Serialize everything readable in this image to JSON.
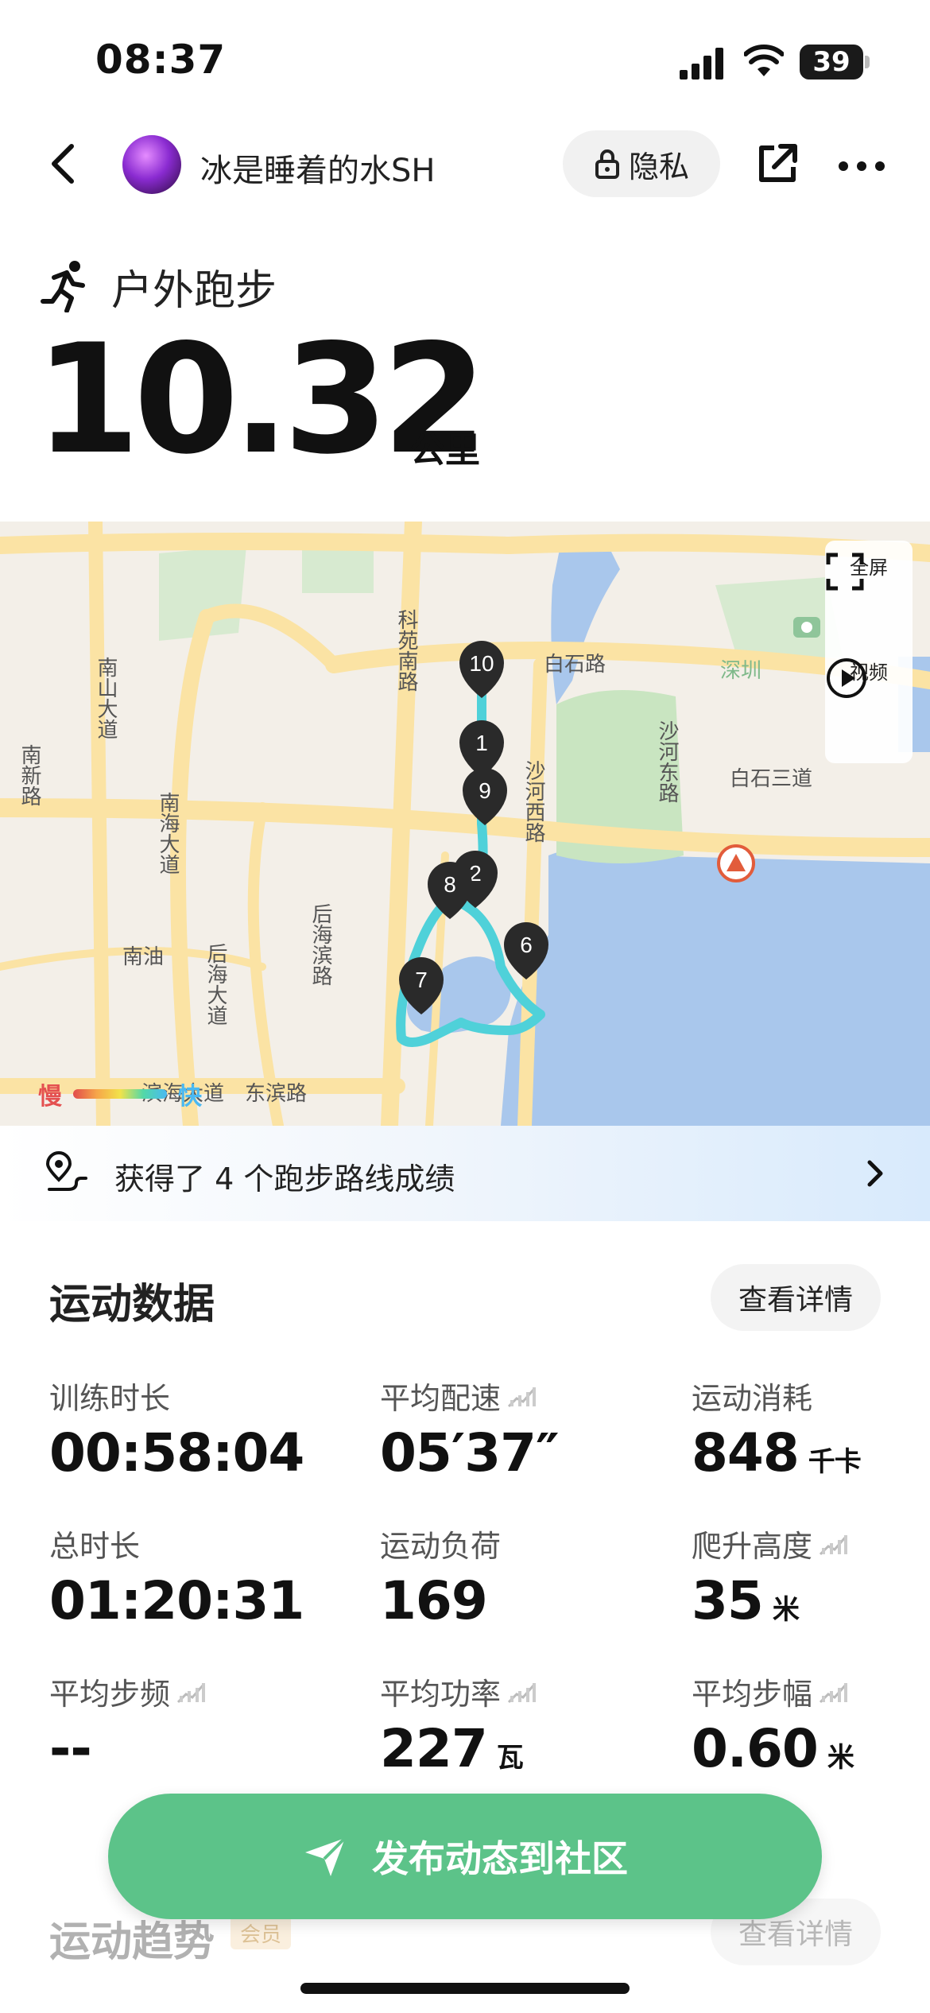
{
  "status": {
    "time": "08:37",
    "battery": "39"
  },
  "nav": {
    "username": "冰是睡着的水SH",
    "privacy_label": "隐私"
  },
  "activity": {
    "type": "户外跑步",
    "distance": "10.32",
    "distance_unit": "公里"
  },
  "map": {
    "street_labels": [
      "白石路",
      "白石三道",
      "南山大道",
      "南新路",
      "南海大道",
      "科苑南路",
      "沙河西路",
      "沙河东路",
      "后海滨路",
      "后海大道",
      "南油",
      "滨海大道",
      "东滨路",
      "深圳"
    ],
    "km_markers": [
      "10",
      "1",
      "9",
      "2",
      "8",
      "6",
      "7"
    ],
    "controls": {
      "fullscreen": "全屏",
      "video": "视频"
    },
    "legend": {
      "slow": "慢",
      "fast": "快"
    },
    "colors": {
      "route": "#4fd1d9",
      "road": "#fbe3a4",
      "water": "#a9c7ec",
      "park": "#c9e5c1"
    }
  },
  "achievement": {
    "text": "获得了 4 个跑步路线成绩"
  },
  "stats_section": {
    "title": "运动数据",
    "detail_label": "查看详情",
    "items": [
      {
        "label": "训练时长",
        "value": "00:58:04",
        "unit": ""
      },
      {
        "label": "平均配速",
        "value": "05′37″",
        "unit": ""
      },
      {
        "label": "运动消耗",
        "value": "848",
        "unit": "千卡"
      },
      {
        "label": "总时长",
        "value": "01:20:31",
        "unit": ""
      },
      {
        "label": "运动负荷",
        "value": "169",
        "unit": ""
      },
      {
        "label": "爬升高度",
        "value": "35",
        "unit": "米"
      },
      {
        "label": "平均步频",
        "value": "--",
        "unit": ""
      },
      {
        "label": "平均功率",
        "value": "227",
        "unit": "瓦"
      },
      {
        "label": "平均步幅",
        "value": "0.60",
        "unit": "米"
      }
    ]
  },
  "publish": {
    "label": "发布动态到社区"
  },
  "trend": {
    "title": "运动趋势",
    "badge": "会员",
    "detail_label": "查看详情"
  }
}
